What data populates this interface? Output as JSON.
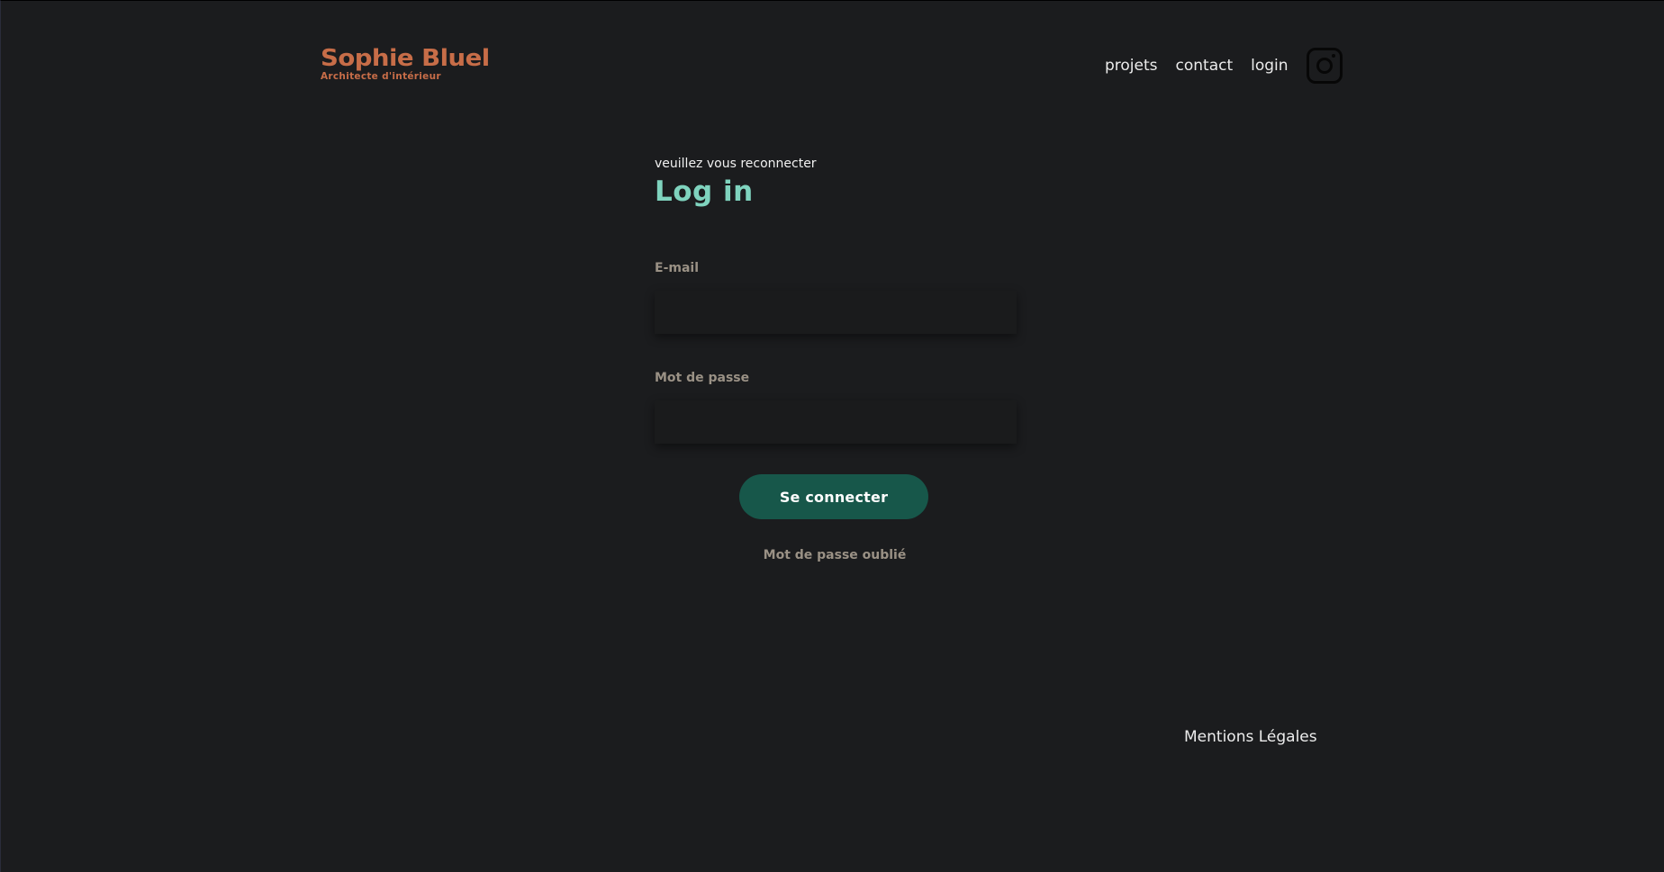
{
  "header": {
    "logo_name": "Sophie Bluel",
    "logo_subtitle": "Architecte d'intérieur",
    "nav": {
      "projects": "projets",
      "contact": "contact",
      "login": "login"
    },
    "instagram_icon": "instagram-icon"
  },
  "login": {
    "intro": "veuillez vous reconnecter",
    "title": "Log in",
    "email_label": "E-mail",
    "email_value": "",
    "password_label": "Mot de passe",
    "password_value": "",
    "submit_label": "Se connecter",
    "forgot_label": "Mot de passe oublié"
  },
  "footer": {
    "legal": "Mentions Légales"
  },
  "colors": {
    "background": "#1b1c1e",
    "brand": "#c76d48",
    "title": "#7fd3be",
    "button": "#17574a",
    "muted_label": "#9a9185"
  }
}
